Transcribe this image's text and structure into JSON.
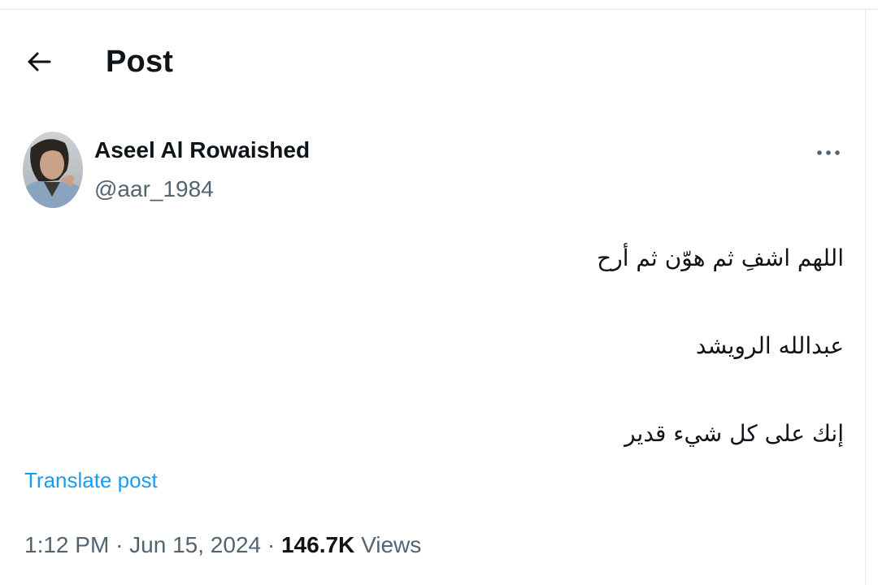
{
  "header": {
    "back_icon": "arrow-left-icon",
    "title": "Post"
  },
  "author": {
    "display_name": "Aseel Al Rowaished",
    "handle": "@aar_1984",
    "avatar_icon": "profile-photo"
  },
  "more_icon": "more-horizontal-icon",
  "tweet": {
    "lines": [
      "اللهم اشفِ ثم هوّن ثم أرح",
      "عبدالله الرويشد",
      "إنك على كل شيء قدير"
    ]
  },
  "translate_label": "Translate post",
  "meta": {
    "time": "1:12 PM",
    "separator": "·",
    "date": "Jun 15, 2024",
    "views_count": "146.7K",
    "views_label": "Views"
  },
  "colors": {
    "text": "#0f1419",
    "secondary": "#536471",
    "accent": "#1d9bf0"
  }
}
